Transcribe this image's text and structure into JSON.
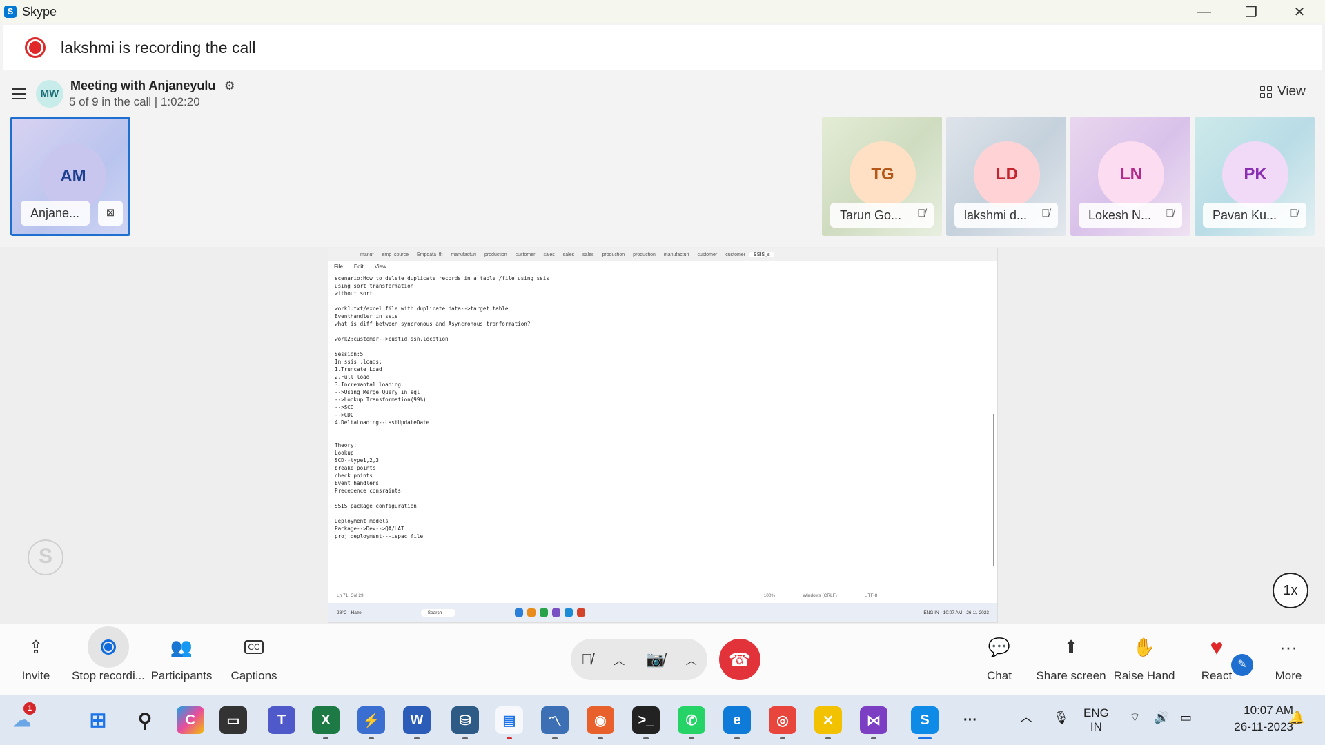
{
  "window": {
    "title": "Skype",
    "minimize": "—",
    "restore": "❐",
    "close": "✕"
  },
  "recording_banner": {
    "text": "lakshmi is recording the call"
  },
  "meeting": {
    "avatar": "MW",
    "title": "Meeting with Anjaneyulu",
    "subtitle": "5 of 9 in the call | 1:02:20",
    "view_label": "View"
  },
  "participants": [
    {
      "initials": "AM",
      "name": "Anjane...",
      "bg": "#c8c6ee",
      "fg": "#1f3f8f"
    },
    {
      "initials": "TG",
      "name": "Tarun Go...",
      "bg": "#ffe0c4",
      "fg": "#b4581a"
    },
    {
      "initials": "LD",
      "name": "lakshmi d...",
      "bg": "#ffd3d6",
      "fg": "#c3262f"
    },
    {
      "initials": "LN",
      "name": "Lokesh N...",
      "bg": "#fbdcf0",
      "fg": "#b42a8a"
    },
    {
      "initials": "PK",
      "name": "Pavan Ku...",
      "bg": "#f1daf8",
      "fg": "#8a2fb4"
    }
  ],
  "shared_screen": {
    "tabs": [
      "manuf",
      "emp_source",
      "Empdata_flt",
      "manufacturi",
      "production",
      "customer",
      "sales",
      "sales",
      "sales",
      "production",
      "production",
      "manufacturi",
      "customer",
      "customer",
      "SSIS_s"
    ],
    "menu": [
      "File",
      "Edit",
      "View"
    ],
    "lines": [
      "scenario:How to delete duplicate records in a table /file using ssis",
      "using sort transformation",
      "without sort",
      "",
      "work1:txt/excel file with duplicate data-->target table",
      "Eventhandler in ssis",
      "what is diff between syncronous and Asyncronous tranformation?",
      "",
      "work2:customer-->custid,ssn,location",
      "",
      "Session:5",
      "In ssis ,loads:",
      "1.Truncate Load",
      "2.Full load",
      "3.Incremantal loading",
      "-->Using Merge Query in sql",
      "-->Lookup Transformation(99%)",
      "-->SCD",
      "-->CDC",
      "4.DeltaLoading--LastUpdateDate",
      "",
      "",
      "Theory:",
      "Lookup",
      "SCD--type1,2,3",
      "breake points",
      "check points",
      "Event handlers",
      "Precedence consraints",
      "",
      "SSIS package configuration",
      "",
      "Deployment models",
      "Package-->Dev-->QA/UAT",
      "proj deployment---ispac file"
    ],
    "status": [
      "Ln 71, Col 29",
      "100%",
      "Windows (CRLF)",
      "UTF-8"
    ],
    "inner_taskbar": {
      "temp": "28°C",
      "weather": "Haze",
      "search": "Search",
      "lang": "ENG IN",
      "time": "10:07 AM",
      "date": "26-11-2023"
    }
  },
  "speed": "1x",
  "controls": {
    "invite": "Invite",
    "stop_recording": "Stop recordi...",
    "participants": "Participants",
    "captions": "Captions",
    "chat": "Chat",
    "share_screen": "Share screen",
    "raise_hand": "Raise Hand",
    "react": "React",
    "more": "More"
  },
  "taskbar": {
    "notification_count": "1",
    "lang_line1": "ENG",
    "lang_line2": "IN",
    "time": "10:07 AM",
    "date": "26-11-2023"
  },
  "colors": {
    "accent": "#0f6bdc",
    "hangup": "#e2333b",
    "record": "#e0282b",
    "selected_tile_border": "#1f6fd1"
  }
}
